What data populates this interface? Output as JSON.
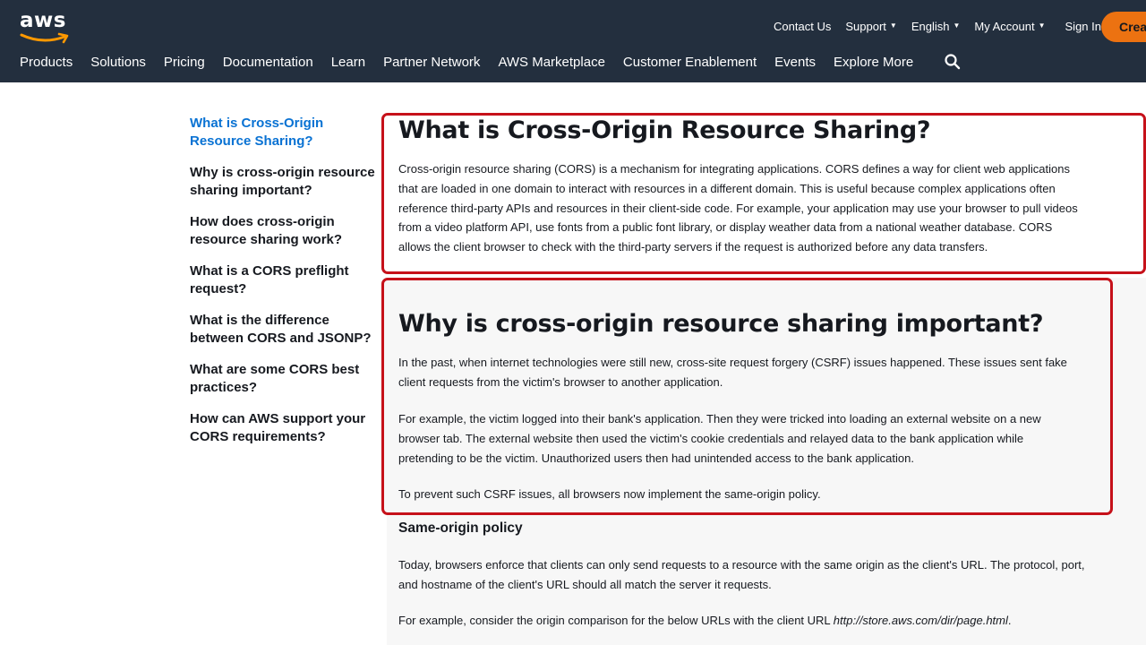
{
  "header": {
    "logo_text": "aws",
    "util_nav": {
      "contact": "Contact Us",
      "support": "Support",
      "language": "English",
      "account": "My Account",
      "signin": "Sign In",
      "create": "Crea"
    },
    "main_nav": [
      "Products",
      "Solutions",
      "Pricing",
      "Documentation",
      "Learn",
      "Partner Network",
      "AWS Marketplace",
      "Customer Enablement",
      "Events",
      "Explore More"
    ]
  },
  "sidenav": {
    "items": [
      "What is Cross-Origin Resource Sharing?",
      "Why is cross-origin resource sharing important?",
      "How does cross-origin resource sharing work?",
      "What is a CORS preflight request?",
      "What is the difference between CORS and JSONP?",
      "What are some CORS best practices?",
      "How can AWS support your CORS requirements?"
    ]
  },
  "section1": {
    "title": "What is Cross-Origin Resource Sharing?",
    "lines": [
      "Cross-origin resource sharing (CORS) is a mechanism for integrating applications. CORS defines a way for client web applications",
      "that are loaded in one domain to interact with resources in a different domain. This is useful because complex applications often",
      "reference third-party APIs and resources in their client-side code. For example, your application may use your browser to pull videos",
      "from a video platform API, use fonts from a public font library, or display weather data from a national weather database. CORS",
      "allows the client browser to check with the third-party servers if the request is authorized before any data transfers."
    ]
  },
  "section2": {
    "title": "Why is cross-origin resource sharing important?",
    "p1": [
      "In the past, when internet technologies were still new, cross-site request forgery (CSRF) issues happened. These issues sent fake",
      "client requests from the victim's browser to another application."
    ],
    "p2": [
      "For example, the victim logged into their bank's application. Then they were tricked into loading an external website on a new",
      "browser tab. The external website then used the victim's cookie credentials and relayed data to the bank application while",
      "pretending to be the victim. Unauthorized users then had unintended access to the bank application."
    ],
    "p3": "To prevent such CSRF issues, all browsers now implement the same-origin policy."
  },
  "section3": {
    "title": "Same-origin policy",
    "p1": [
      "Today, browsers enforce that clients can only send requests to a resource with the same origin as the client's URL. The protocol, port,",
      "and hostname of the client's URL should all match the server it requests."
    ],
    "p2_prefix": "For example, consider the origin comparison for the below URLs with the client URL ",
    "p2_url": "http://store.aws.com/dir/page.html",
    "p2_suffix": "."
  },
  "colors": {
    "header_bg": "#232f3e",
    "accent_orange": "#ec7211",
    "active_link": "#0972d3",
    "highlight_border": "#c6111a"
  }
}
